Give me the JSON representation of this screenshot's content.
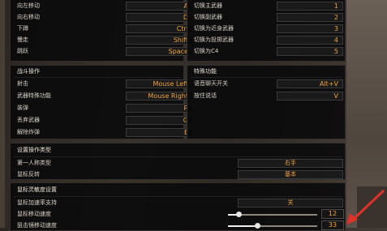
{
  "movement": {
    "rows": [
      {
        "label": "向左移动",
        "key": "A"
      },
      {
        "label": "向右移动",
        "key": "D"
      },
      {
        "label": "下蹲",
        "key": "Ctrl"
      },
      {
        "label": "慢走",
        "key": "Shift"
      },
      {
        "label": "跳跃",
        "key": "Space"
      }
    ]
  },
  "weapons": {
    "rows": [
      {
        "label": "切换主武器",
        "key": "1"
      },
      {
        "label": "切换副武器",
        "key": "2"
      },
      {
        "label": "切换为近身武器",
        "key": "3"
      },
      {
        "label": "切换为投掷武器",
        "key": "4"
      },
      {
        "label": "切换为C4",
        "key": "5"
      }
    ]
  },
  "combat": {
    "title": "战斗操作",
    "rows": [
      {
        "label": "射击",
        "key": "Mouse Left"
      },
      {
        "label": "武器特殊功能",
        "key": "Mouse Right"
      },
      {
        "label": "装弹",
        "key": "R"
      },
      {
        "label": "丢弃武器",
        "key": "G"
      },
      {
        "label": "解除炸弹",
        "key": "E"
      }
    ]
  },
  "special": {
    "title": "特殊功能",
    "rows": [
      {
        "label": "语音聊天开关",
        "key": "Alt+V"
      },
      {
        "label": "按住说话",
        "key": "V"
      }
    ]
  },
  "device": {
    "title": "设置操作类型",
    "rows": [
      {
        "label": "第一人称类型",
        "value": "右手"
      },
      {
        "label": "鼠标反转",
        "value": "基本"
      }
    ]
  },
  "mouse": {
    "title": "鼠标灵敏度设置",
    "rows": [
      {
        "label": "鼠标加速率支持",
        "value": "关"
      },
      {
        "label": "鼠标移动速度",
        "number": "12",
        "fraction": 0.12
      },
      {
        "label": "狙击镜移动速度",
        "number": "33",
        "fraction": 0.33
      }
    ]
  },
  "colors": {
    "accent": "#f0a540",
    "arrow": "#e0322b"
  }
}
